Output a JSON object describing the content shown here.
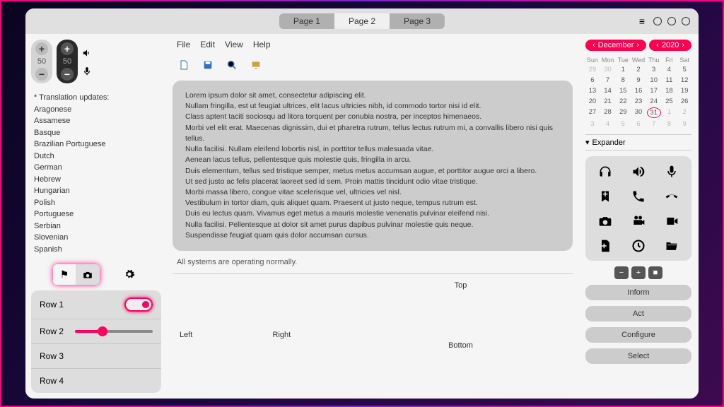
{
  "tabs": [
    "Page 1",
    "Page 2",
    "Page 3"
  ],
  "active_tab": 1,
  "spinners": {
    "light_value": "50",
    "dark_value": "50"
  },
  "languages": {
    "header": "* Translation updates:",
    "items": [
      "Aragonese",
      "Assamese",
      "Basque",
      "Brazilian Portuguese",
      "Dutch",
      "German",
      "Hebrew",
      "Hungarian",
      "Polish",
      "Portuguese",
      "Serbian",
      "Slovenian",
      "Spanish"
    ]
  },
  "rows": [
    "Row 1",
    "Row 2",
    "Row 3",
    "Row 4"
  ],
  "menubar": [
    "File",
    "Edit",
    "View",
    "Help"
  ],
  "lipsum": [
    "Lorem ipsum dolor sit amet, consectetur adipiscing elit.",
    "Nullam fringilla, est ut feugiat ultrices, elit lacus ultricies nibh, id commodo tortor nisi id elit.",
    "Class aptent taciti sociosqu ad litora torquent per conubia nostra, per inceptos himenaeos.",
    "Morbi vel elit erat. Maecenas dignissim, dui et pharetra rutrum, tellus lectus rutrum mi, a convallis libero nisi quis tellus.",
    "Nulla facilisi. Nullam eleifend lobortis nisl, in porttitor tellus malesuada vitae.",
    "Aenean lacus tellus, pellentesque quis molestie quis, fringilla in arcu.",
    "Duis elementum, tellus sed tristique semper, metus metus accumsan augue, et porttitor augue orci a libero.",
    "Ut sed justo ac felis placerat laoreet sed id sem. Proin mattis tincidunt odio vitae tristique.",
    "Morbi massa libero, congue vitae scelerisque vel, ultricies vel nisl.",
    "Vestibulum in tortor diam, quis aliquet quam. Praesent ut justo neque, tempus rutrum est.",
    "Duis eu lectus quam. Vivamus eget metus a mauris molestie venenatis pulvinar eleifend nisi.",
    "Nulla facilisi. Pellentesque at dolor sit amet purus dapibus pulvinar molestie quis neque.",
    "Suspendisse feugiat quam quis dolor accumsan cursus."
  ],
  "status_text": "All systems are operating normally.",
  "cross": {
    "top": "Top",
    "left": "Left",
    "right": "Right",
    "bottom": "Bottom"
  },
  "calendar": {
    "month": "December",
    "year": "2020",
    "dow": [
      "Sun",
      "Mon",
      "Tue",
      "Wed",
      "Thu",
      "Fri",
      "Sat"
    ],
    "leading_dim": [
      "29",
      "30"
    ],
    "days": [
      "1",
      "2",
      "3",
      "4",
      "5",
      "6",
      "7",
      "8",
      "9",
      "10",
      "11",
      "12",
      "13",
      "14",
      "15",
      "16",
      "17",
      "18",
      "19",
      "20",
      "21",
      "22",
      "23",
      "24",
      "25",
      "26",
      "27",
      "28",
      "29",
      "30",
      "31"
    ],
    "trailing_dim": [
      "1",
      "2",
      "3",
      "4",
      "5",
      "6",
      "7",
      "8",
      "9"
    ],
    "today": "31"
  },
  "expander_label": "Expander",
  "action_buttons": [
    "Inform",
    "Act",
    "Configure",
    "Select"
  ],
  "mini_buttons": [
    "−",
    "+",
    "■"
  ]
}
